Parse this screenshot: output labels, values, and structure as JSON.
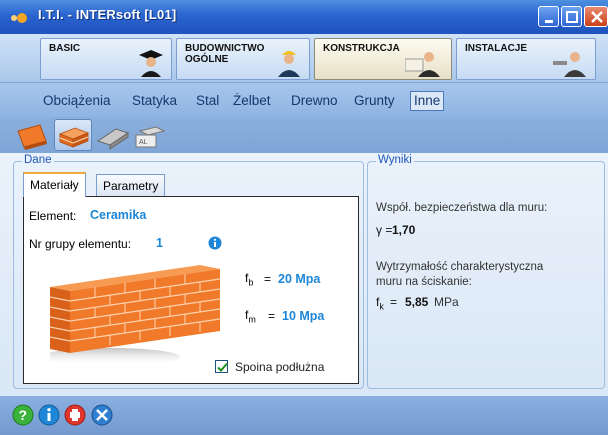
{
  "window": {
    "title": "I.T.I. - INTERsoft [L01]"
  },
  "modules": [
    {
      "label": "BASIC"
    },
    {
      "label": "BUDOWNICTWO\nOGÓLNE"
    },
    {
      "label": "KONSTRUKCJA"
    },
    {
      "label": "INSTALACJE"
    }
  ],
  "menu": [
    "Obciążenia",
    "Statyka",
    "Stal",
    "Żelbet",
    "Drewno",
    "Grunty",
    "Inne"
  ],
  "dane": {
    "title": "Dane",
    "tabs": [
      "Materiały",
      "Parametry"
    ],
    "element_label": "Element:",
    "element_value": "Ceramika",
    "nr_label": "Nr grupy elementu:",
    "nr_value": "1",
    "fb_eq": "=",
    "fb_value": "20 Mpa",
    "fm_eq": "=",
    "fm_value": "10 Mpa",
    "checkbox_label": "Spoina podłużna",
    "checkbox_checked": true
  },
  "wyniki": {
    "title": "Wyniki",
    "line1": "Współ. bezpieczeństwa dla muru:",
    "gamma_sym": "γ =",
    "gamma_val": "1,70",
    "line2a": "Wytrzymałość charakterystyczna",
    "line2b": "muru na ściskanie:",
    "fk_eq": "=",
    "fk_val": "5,85",
    "fk_unit": "MPa"
  },
  "colors": {
    "titlebar": "#2a64cf",
    "accent_blue": "#1d86d6",
    "brick": "#f07a2a"
  },
  "bottom_icons": [
    "help-icon",
    "info-icon",
    "print-icon",
    "tools-icon"
  ]
}
